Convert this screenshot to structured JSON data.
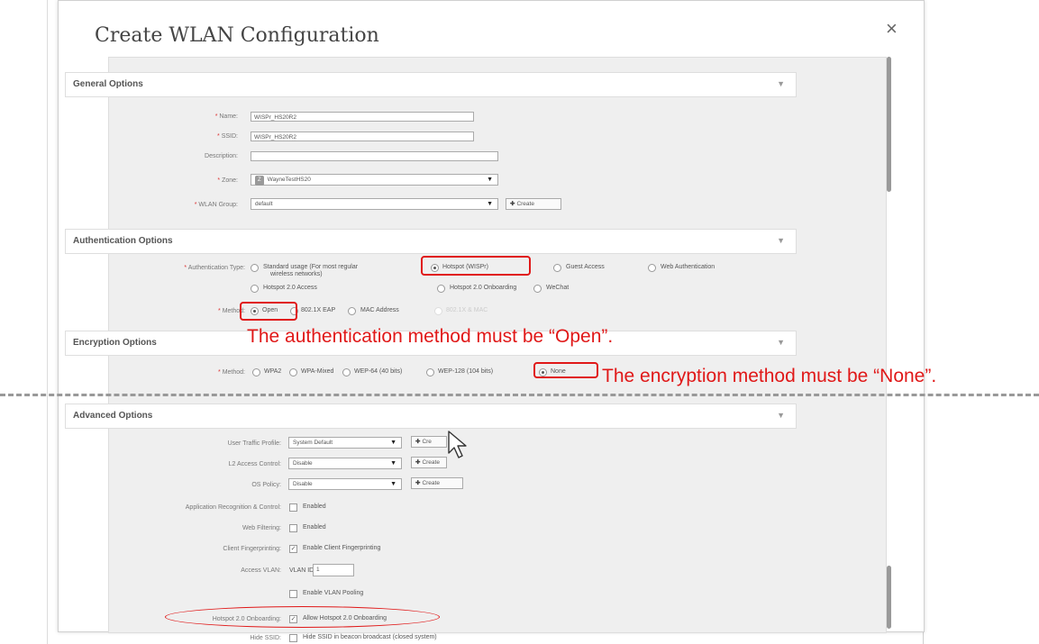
{
  "dialog": {
    "title": "Create WLAN Configuration",
    "close_symbol": "×"
  },
  "sections": {
    "general": "General Options",
    "auth": "Authentication Options",
    "encryption": "Encryption Options",
    "advanced": "Advanced Options",
    "chevron": "▼"
  },
  "general": {
    "name_label": "Name:",
    "name_value": "WISPr_HS20R2",
    "ssid_label": "SSID:",
    "ssid_value": "WISPr_HS20R2",
    "description_label": "Description:",
    "description_value": "",
    "zone_label": "Zone:",
    "zone_badge": "Z",
    "zone_value": "WayneTestHS20",
    "wlan_group_label": "WLAN Group:",
    "wlan_group_value": "default",
    "create_label": "Create"
  },
  "auth": {
    "type_label": "Authentication Type:",
    "options": [
      "Standard usage (For most regular",
      "wireless networks)",
      "Hotspot (WISPr)",
      "Guest Access",
      "Web Authentication",
      "Hotspot 2.0 Access",
      "Hotspot 2.0 Onboarding",
      "WeChat"
    ],
    "method_label": "Method:",
    "methods": [
      "Open",
      "802.1X EAP",
      "MAC Address",
      "802.1X & MAC"
    ]
  },
  "encryption": {
    "method_label": "Method:",
    "methods": [
      "WPA2",
      "WPA-Mixed",
      "WEP-64 (40 bits)",
      "WEP-128 (104 bits)",
      "None"
    ]
  },
  "advanced": {
    "user_traffic_label": "User Traffic Profile:",
    "user_traffic_value": "System Default",
    "l2_label": "L2 Access Control:",
    "l2_value": "Disable",
    "os_label": "OS Policy:",
    "os_value": "Disable",
    "create_short": "Cre",
    "create_label": "Create",
    "app_label": "Application Recognition & Control:",
    "web_label": "Web Filtering:",
    "enabled": "Enabled",
    "fingerprint_label": "Client Fingerprinting:",
    "fingerprint_text": "Enable Client Fingerprinting",
    "vlan_label": "Access VLAN:",
    "vlan_id_label": "VLAN ID",
    "vlan_id_value": "1",
    "vlan_pooling": "Enable VLAN Pooling",
    "hs20_label": "Hotspot 2.0 Onboarding:",
    "hs20_text": "Allow Hotspot 2.0 Onboarding",
    "hide_ssid_label": "Hide SSID:",
    "hide_ssid_text": "Hide SSID in beacon broadcast (closed system)"
  },
  "annotations": {
    "auth_note": "The authentication method must be “Open”.",
    "enc_note": "The encryption method must be “None”."
  },
  "colors": {
    "highlight": "#e01818",
    "panel": "#efefef"
  }
}
